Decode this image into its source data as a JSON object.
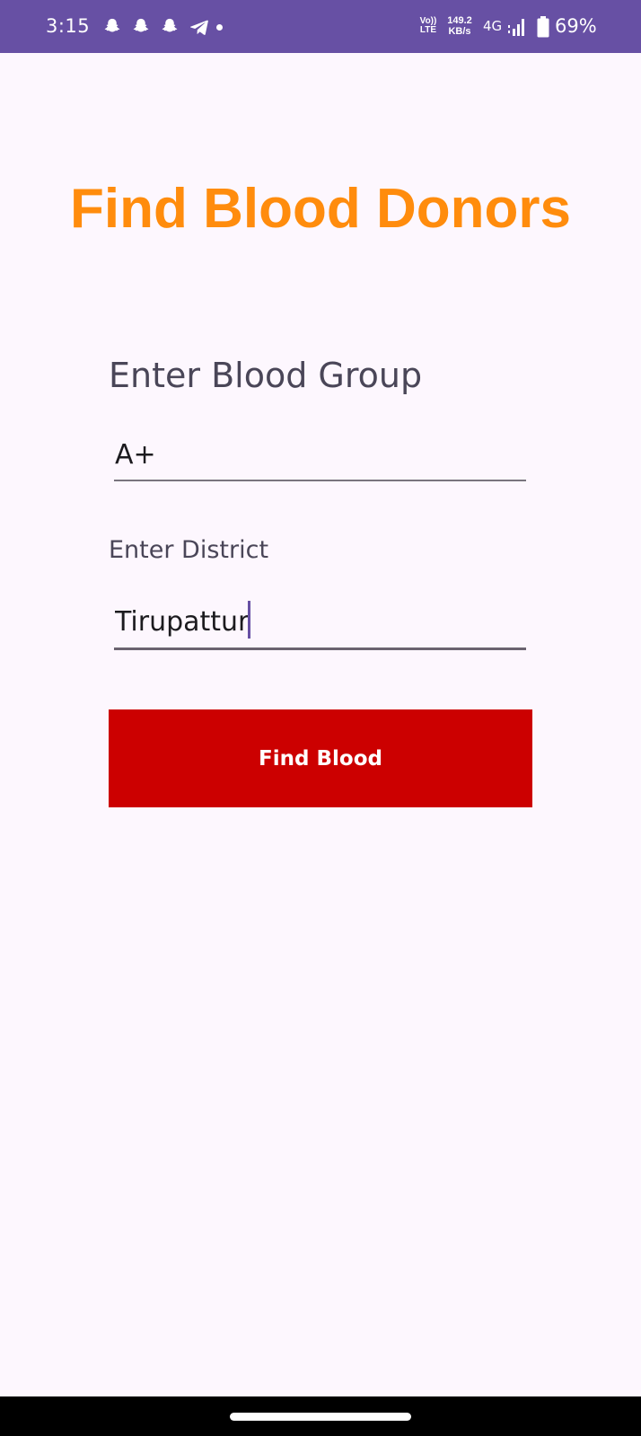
{
  "status_bar": {
    "time": "3:15",
    "notification_icons": [
      "snapchat-icon",
      "snapchat-icon",
      "snapchat-icon",
      "telegram-icon"
    ],
    "volte_top": "Vo))",
    "volte_bottom": "LTE",
    "speed_value": "149.2",
    "speed_unit": "KB/s",
    "network": "4G",
    "battery_percent": "69%",
    "background_color": "#6750a4"
  },
  "screen": {
    "title": "Find Blood Donors",
    "blood_group_label": "Enter Blood Group",
    "blood_group_value": "A+",
    "district_label": "Enter District",
    "district_value": "Tirupattur",
    "find_button_label": "Find Blood",
    "title_color": "#ff8c0d",
    "button_color": "#cc0000",
    "background_color": "#fdf7fe"
  }
}
